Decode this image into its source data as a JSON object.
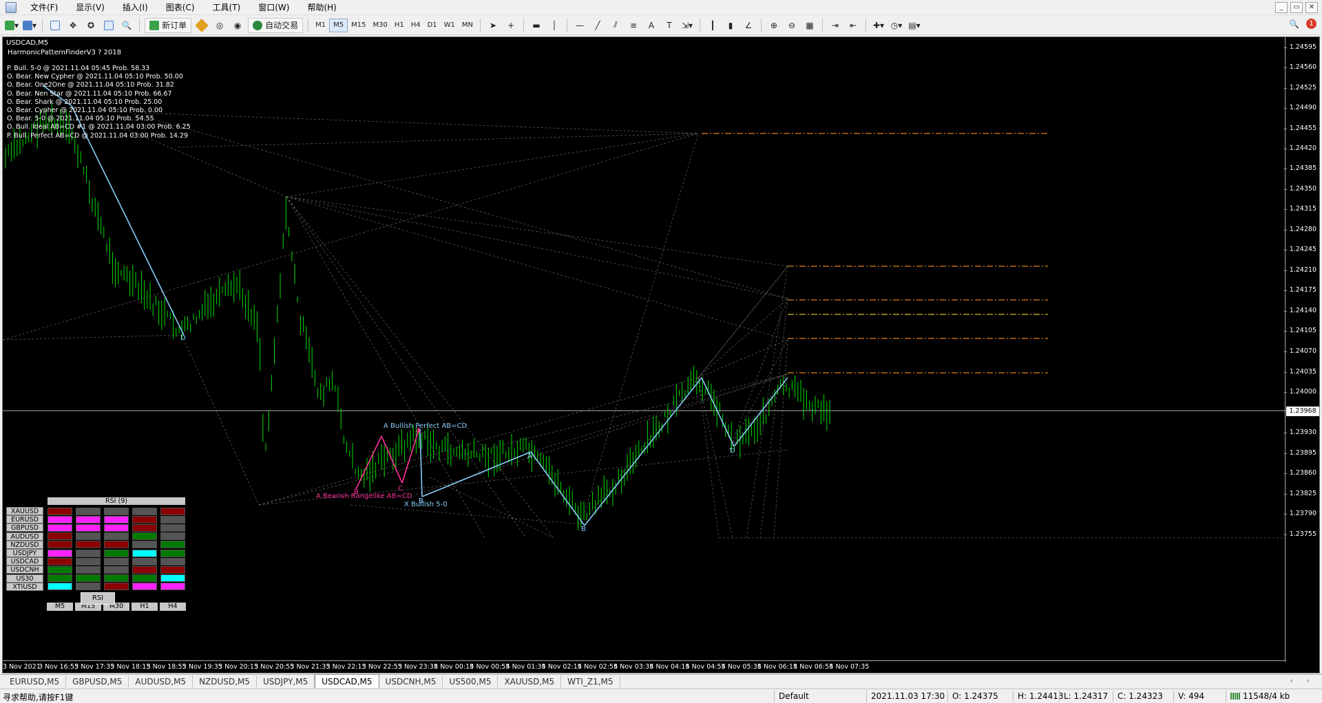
{
  "menu": {
    "items": [
      "文件(F)",
      "显示(V)",
      "插入(I)",
      "图表(C)",
      "工具(T)",
      "窗口(W)",
      "帮助(H)"
    ]
  },
  "toolbar": {
    "new_order": "新订单",
    "auto_trade": "自动交易",
    "timeframes": [
      "M1",
      "M5",
      "M15",
      "M30",
      "H1",
      "H4",
      "D1",
      "W1",
      "MN"
    ],
    "active_timeframe": "M5",
    "notification_count": "1"
  },
  "chart": {
    "symbol_title": "USDCAD,M5",
    "indicator_title": "HarmonicPatternFinderV3 ? 2018",
    "patterns": [
      "P. Bull. 5-0 @ 2021.11.04 05:45 Prob. 58.33",
      "O. Bear. New Cypher @ 2021.11.04 05:10 Prob. 50.00",
      "O. Bear. One2One @ 2021.11.04 05:10 Prob. 31.82",
      "O. Bear. Nen Star @ 2021.11.04 05:10 Prob. 66.67",
      "O. Bear. Shark @ 2021.11.04 05:10 Prob. 25.00",
      "O. Bear. Cypher @ 2021.11.04 05:10 Prob. 0.00",
      "O. Bear. 5-0 @ 2021.11.04 05:10 Prob. 54.55",
      "O. Bull. Ideal AB=CD #1 @ 2021.11.04 03:00 Prob. 6.25",
      "P. Bull. Perfect AB=CD @ 2021.11.04 03:00 Prob. 14.29"
    ],
    "price_labels": [
      "1.24595",
      "1.24560",
      "1.24525",
      "1.24490",
      "1.24455",
      "1.24420",
      "1.24385",
      "1.24350",
      "1.24315",
      "1.24280",
      "1.24245",
      "1.24210",
      "1.24175",
      "1.24140",
      "1.24105",
      "1.24070",
      "1.24035",
      "1.24000",
      "1.23930",
      "1.23895",
      "1.23860",
      "1.23825",
      "1.23790",
      "1.23755"
    ],
    "current_price": "1.23968",
    "time_labels": [
      "3 Nov 2021",
      "3 Nov 16:55",
      "3 Nov 17:35",
      "3 Nov 18:15",
      "3 Nov 18:55",
      "3 Nov 19:35",
      "3 Nov 20:15",
      "3 Nov 20:55",
      "3 Nov 21:35",
      "3 Nov 22:15",
      "3 Nov 22:55",
      "3 Nov 23:35",
      "4 Nov 00:15",
      "4 Nov 00:55",
      "4 Nov 01:35",
      "4 Nov 02:15",
      "4 Nov 02:55",
      "4 Nov 03:35",
      "4 Nov 04:15",
      "4 Nov 04:55",
      "4 Nov 05:35",
      "4 Nov 06:15",
      "4 Nov 06:55",
      "4 Nov 07:35"
    ],
    "pattern_labels": {
      "bullish_perfect": "A Bullish Perfect AB=CD",
      "bearish_rangelike": "A Bearish Rangelike AB=CD",
      "bullish_50": "X Bullish 5-0",
      "D1": "D",
      "D2": "D",
      "B": "B",
      "C": "C",
      "A": "A",
      "Bb": "B",
      "Bm": "B",
      "Am": "A"
    },
    "colors": {
      "candle": "#00e000",
      "pattern_line": "#87cefa",
      "bearish_line": "#ff3399",
      "fib_orange": "#e08020",
      "fib_yellow": "#d8c020",
      "dashed_gray": "#7a7a7a"
    }
  },
  "rsi_panel": {
    "title": "RSI (9)",
    "symbols": [
      "XAUUSD",
      "EURUSD",
      "GBPUSD",
      "AUDUSD",
      "NZDUSD",
      "USDJPY",
      "USDCAD",
      "USDCNH",
      "US30",
      "XTIUSD"
    ],
    "timeframes": [
      "M5",
      "M15",
      "M30",
      "H1",
      "H4"
    ],
    "cells": [
      [
        "#8b0000",
        "#555555",
        "#555555",
        "#555555",
        "#8b0000"
      ],
      [
        "#ff22ff",
        "#ff22ff",
        "#ff22ff",
        "#8b0000",
        "#555555"
      ],
      [
        "#ff22ff",
        "#ff22ff",
        "#ff22ff",
        "#8b0000",
        "#555555"
      ],
      [
        "#8b0000",
        "#555555",
        "#555555",
        "#007a00",
        "#555555"
      ],
      [
        "#8b0000",
        "#8b0000",
        "#8b0000",
        "#555555",
        "#007a00"
      ],
      [
        "#ff22ff",
        "#555555",
        "#007a00",
        "#00ffff",
        "#007a00"
      ],
      [
        "#8b0000",
        "#555555",
        "#555555",
        "#555555",
        "#555555"
      ],
      [
        "#007a00",
        "#555555",
        "#555555",
        "#8b0000",
        "#8b0000"
      ],
      [
        "#007a00",
        "#007a00",
        "#007a00",
        "#007a00",
        "#00ffff"
      ],
      [
        "#00ffff",
        "#555555",
        "#8b0000",
        "#ff22ff",
        "#ff22ff"
      ]
    ],
    "button": "RSI"
  },
  "tabs": {
    "items": [
      "EURUSD,M5",
      "GBPUSD,M5",
      "AUDUSD,M5",
      "NZDUSD,M5",
      "USDJPY,M5",
      "USDCAD,M5",
      "USDCNH,M5",
      "US500,M5",
      "XAUUSD,M5",
      "WTI_Z1,M5"
    ],
    "active": "USDCAD,M5"
  },
  "status": {
    "help": "寻求帮助,请按F1键",
    "profile": "Default",
    "datetime": "2021.11.03 17:30",
    "open": "O: 1.24375",
    "high": "H: 1.24413",
    "low": "L: 1.24317",
    "close": "C: 1.24323",
    "volume": "V: 494",
    "traffic": "11548/4 kb"
  }
}
